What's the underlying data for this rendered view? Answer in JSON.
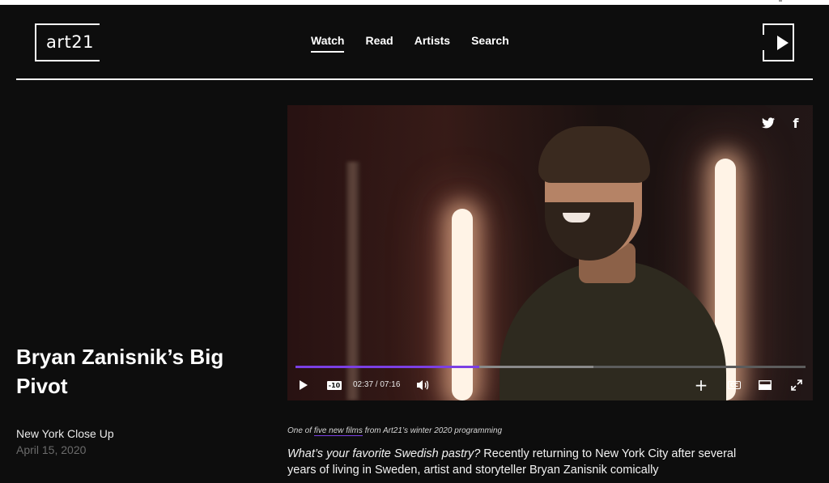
{
  "header": {
    "logo_text": "art21",
    "nav": [
      "Watch",
      "Read",
      "Artists",
      "Search"
    ],
    "active_nav": "Watch",
    "play_logo_icon": "play-triangle-icon"
  },
  "article": {
    "title": "Bryan Zanisnik’s Big Pivot",
    "series": "New York Close Up",
    "date": "April 15, 2020"
  },
  "video": {
    "share": [
      "twitter-icon",
      "facebook-icon"
    ],
    "rewind_label": "-10",
    "time": "02:37 / 07:16",
    "progress_fraction": 0.36,
    "buffered_fraction": 0.584,
    "cc_label": "CC",
    "colors": {
      "progress": "#7b3fe4",
      "buffer": "#8a8a8a",
      "track": "#5c5c5c"
    }
  },
  "caption": {
    "prefix": "One of ",
    "link": "five new films",
    "suffix": " from Art21’s winter 2020 programming"
  },
  "body": {
    "lead_question": "What’s your favorite Swedish pastry?",
    "text": " Recently returning to New York City after several years of living in Sweden, artist and storyteller Bryan Zanisnik comically"
  }
}
